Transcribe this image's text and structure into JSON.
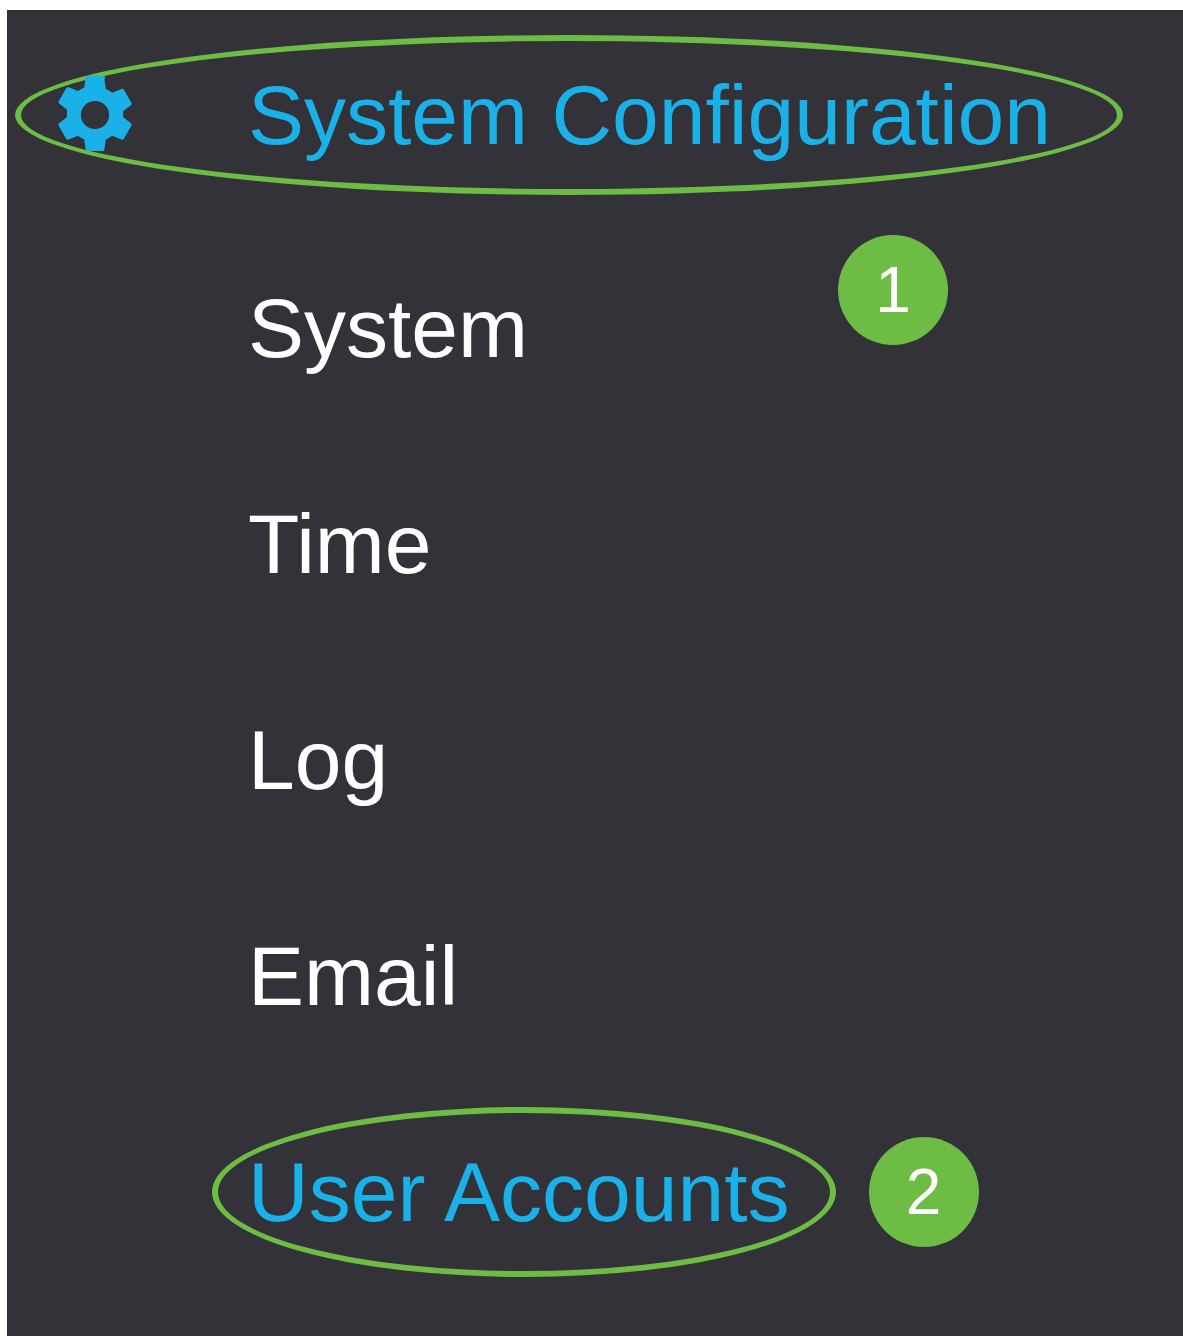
{
  "menu": {
    "header": {
      "label": "System Configuration",
      "circled": true,
      "callout": "1"
    },
    "items": [
      {
        "label": "System",
        "selected": false,
        "circled": false
      },
      {
        "label": "Time",
        "selected": false,
        "circled": false
      },
      {
        "label": "Log",
        "selected": false,
        "circled": false
      },
      {
        "label": "Email",
        "selected": false,
        "circled": false
      },
      {
        "label": "User Accounts",
        "selected": true,
        "circled": true,
        "callout": "2"
      }
    ]
  }
}
